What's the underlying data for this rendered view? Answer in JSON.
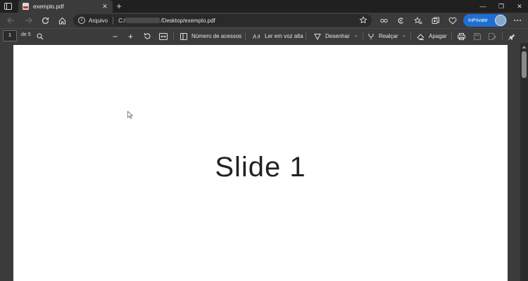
{
  "window": {
    "tab_title": "exemplo.pdf",
    "tab_close": "✕",
    "new_tab": "+",
    "minimize": "—",
    "restore": "❐",
    "close": "✕"
  },
  "address_bar": {
    "site_info_label": "Arquivo",
    "path_prefix": "C:/",
    "path_suffix": "/Desktop/exemplo.pdf"
  },
  "inprivate": {
    "label": "InPrivate"
  },
  "pdf_toolbar": {
    "page_number": "1",
    "page_count": "de 5",
    "zoom_out": "−",
    "zoom_in": "+",
    "view_mode_label": "Número de acessos",
    "read_aloud_label": "Ler em voz alta",
    "draw_label": "Desenhar",
    "highlight_label": "Realçar",
    "erase_label": "Apagar"
  },
  "document": {
    "slide_title": "Slide 1"
  },
  "colors": {
    "accent_inprivate": "#1f6fd1",
    "chrome_dark": "#202020",
    "toolbar": "#3b3b3b",
    "page": "#ffffff"
  }
}
